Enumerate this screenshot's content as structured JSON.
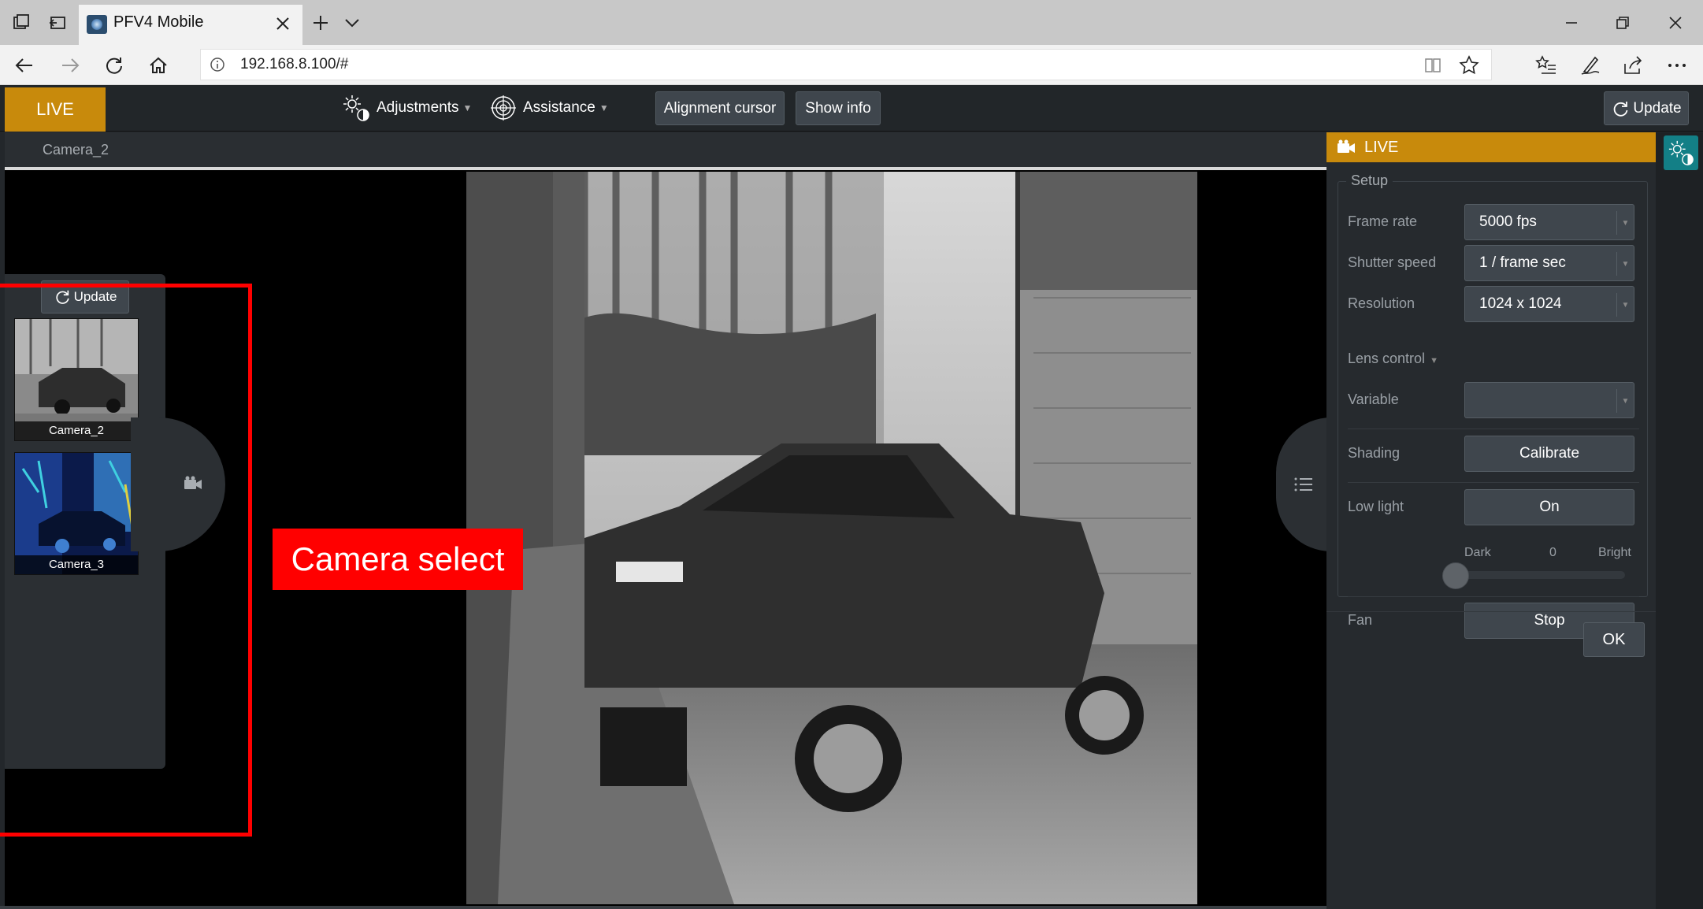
{
  "browser": {
    "tab_title": "PFV4 Mobile",
    "url": "192.168.8.100/#"
  },
  "appbar": {
    "live_label": "LIVE",
    "adjustments_label": "Adjustments",
    "assistance_label": "Assistance",
    "alignment_cursor_label": "Alignment cursor",
    "show_info_label": "Show info",
    "update_label": "Update"
  },
  "view": {
    "camera_name": "Camera_2"
  },
  "camera_panel": {
    "update_label": "Update",
    "cameras": [
      {
        "name": "Camera_2"
      },
      {
        "name": "Camera_3"
      }
    ]
  },
  "annotation": {
    "label": "Camera select",
    "color": "#ff0000"
  },
  "right_panel": {
    "header": "LIVE",
    "setup_legend": "Setup",
    "frame_rate_label": "Frame rate",
    "frame_rate_value": "5000 fps",
    "shutter_label": "Shutter speed",
    "shutter_value": "1 / frame sec",
    "resolution_label": "Resolution",
    "resolution_value": "1024 x 1024",
    "lens_control_label": "Lens control",
    "variable_label": "Variable",
    "variable_value": "",
    "shading_label": "Shading",
    "calibrate_label": "Calibrate",
    "low_light_label": "Low light",
    "low_light_value": "On",
    "slider_min_label": "Dark",
    "slider_value": "0",
    "slider_max_label": "Bright",
    "fan_label": "Fan",
    "fan_button": "Stop",
    "ok_label": "OK"
  },
  "colors": {
    "accent": "#c88a0c",
    "panel": "#262a2e",
    "button": "#3f464d",
    "teal": "#137f86"
  },
  "icons": {
    "camera": "camera-icon",
    "list": "list-icon",
    "adjust": "adjustments-icon",
    "assist": "crosshair-icon",
    "refresh": "refresh-icon"
  }
}
